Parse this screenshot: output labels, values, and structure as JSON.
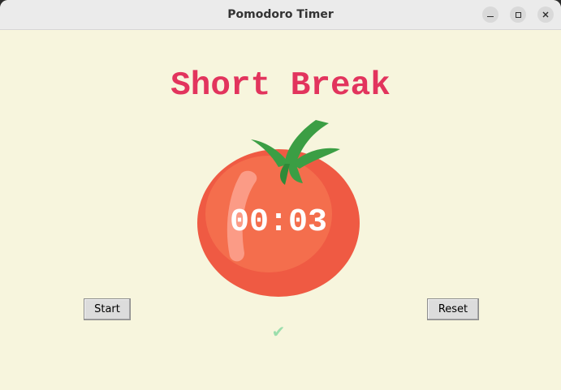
{
  "window": {
    "title": "Pomodoro Timer"
  },
  "heading": {
    "text": "Short Break",
    "color": "#e2345d"
  },
  "timer": {
    "display": "00:03"
  },
  "controls": {
    "start_label": "Start",
    "reset_label": "Reset"
  },
  "progress": {
    "checkmarks": "✔",
    "color": "#9bdeac"
  },
  "icons": {
    "tomato": "tomato-icon",
    "minimize": "minimize-icon",
    "maximize": "maximize-icon",
    "close": "close-icon"
  },
  "colors": {
    "background": "#f7f5dd",
    "tomato_red": "#ef5a43",
    "leaf_green": "#3b9e44"
  }
}
